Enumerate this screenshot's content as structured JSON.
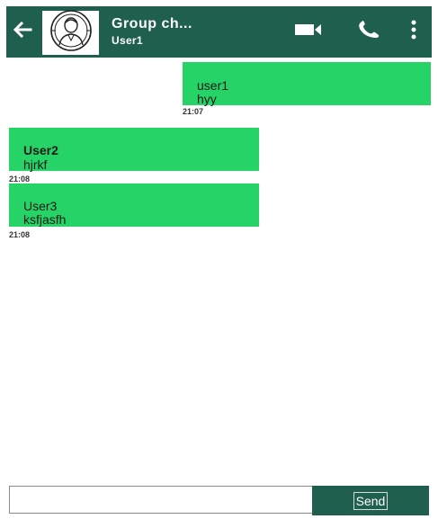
{
  "colors": {
    "header_bg": "#1f5f4e",
    "bubble_bg": "#25d366",
    "send_bg": "#1f5f4e"
  },
  "header": {
    "back_icon": "arrow-left-icon",
    "avatar_icon": "person-avatar-icon",
    "title": "Group ch...",
    "subtitle": "User1",
    "video_icon": "video-camera-icon",
    "call_icon": "phone-icon",
    "more_icon": "more-vertical-icon"
  },
  "messages": [
    {
      "sender": "user1",
      "text": "hyy",
      "time": "21:07",
      "side": "right"
    },
    {
      "sender": "User2",
      "text": "hjrkf",
      "time": "21:08",
      "side": "left"
    },
    {
      "sender": "User3",
      "text": "ksfjasfh",
      "time": "21:08",
      "side": "left"
    }
  ],
  "composer": {
    "input_value": "",
    "input_placeholder": "",
    "send_label": "Send"
  }
}
